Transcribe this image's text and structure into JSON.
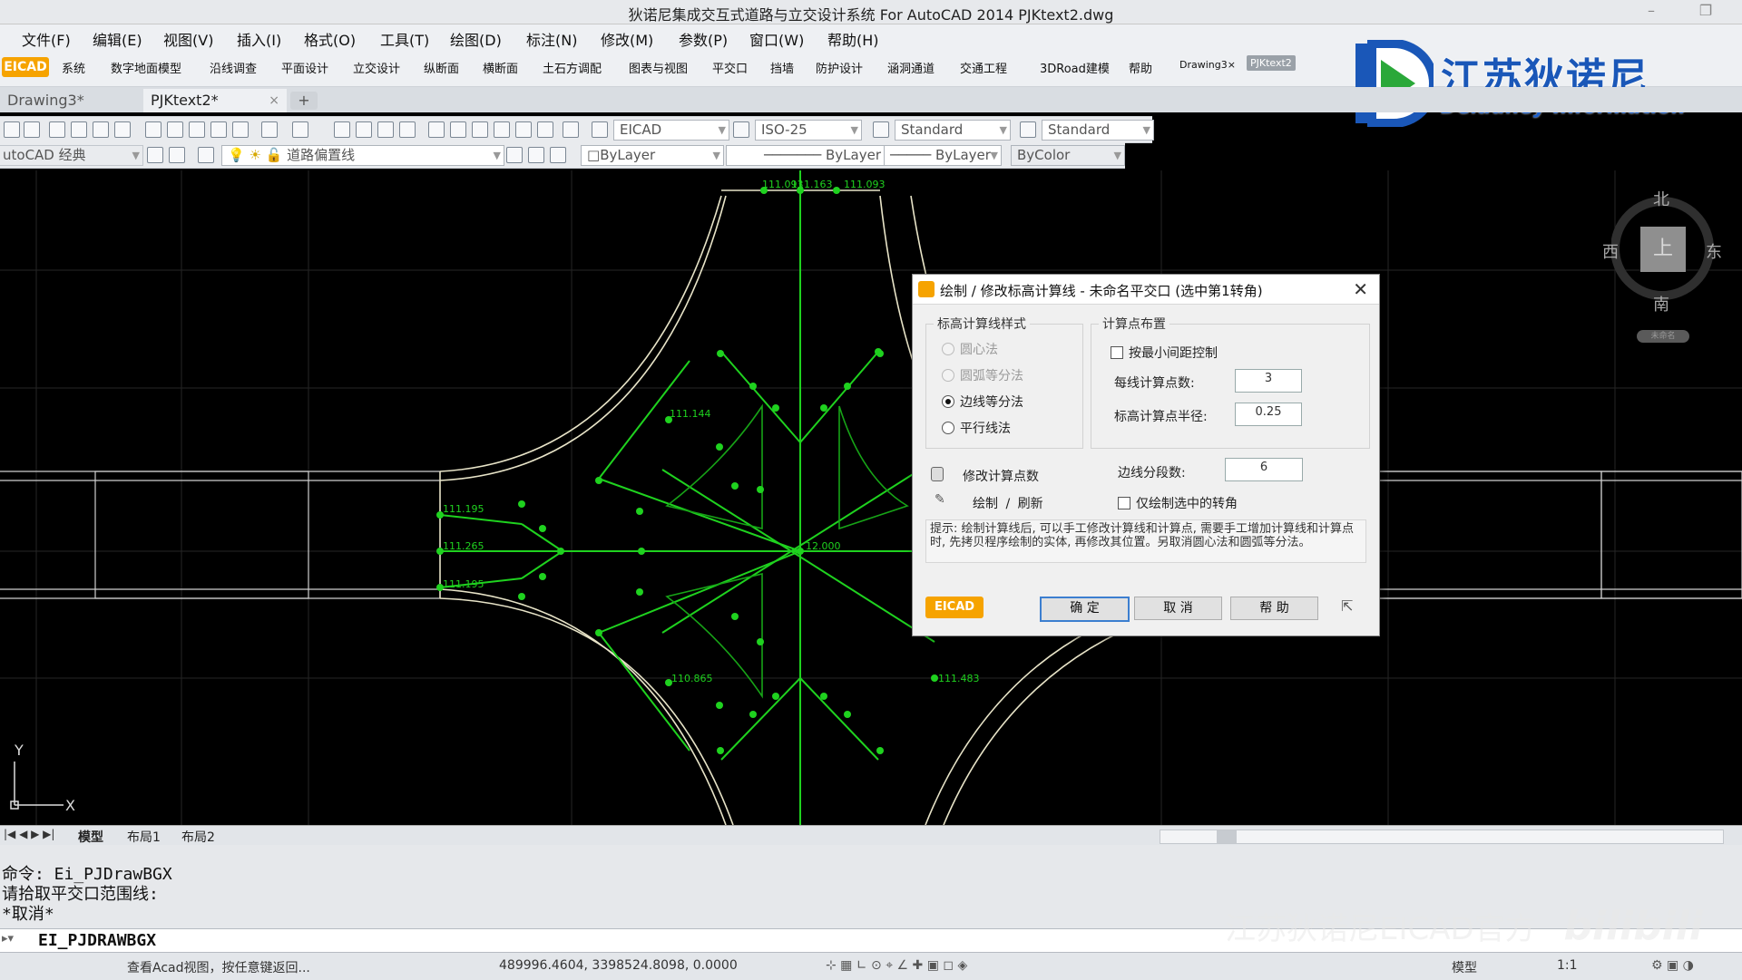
{
  "window": {
    "title": "狄诺尼集成交互式道路与立交设计系统 For AutoCAD 2014    PJKtext2.dwg"
  },
  "menu": [
    "文件(F)",
    "编辑(E)",
    "视图(V)",
    "插入(I)",
    "格式(O)",
    "工具(T)",
    "绘图(D)",
    "标注(N)",
    "修改(M)",
    "参数(P)",
    "窗口(W)",
    "帮助(H)"
  ],
  "ribbon": {
    "logo": "EICAD",
    "items": [
      "系统",
      "数字地面模型",
      "沿线调查",
      "平面设计",
      "立交设计",
      "纵断面",
      "横断面",
      "土石方调配",
      "图表与视图",
      "平交口",
      "挡墙",
      "防护设计",
      "涵洞通道",
      "交通工程",
      "3DRoad建模",
      "帮助",
      "Drawing3×",
      "PJKtext2"
    ]
  },
  "brand": {
    "name_cn": "江苏狄诺尼",
    "name_en": "Delauney Information"
  },
  "tabs": [
    {
      "label": "Drawing3*",
      "close": ""
    },
    {
      "label": "PJKtext2*",
      "close": "×"
    }
  ],
  "toolbar1": {
    "text_style": "EICAD",
    "dim_style": "ISO-25",
    "table_style": "Standard",
    "ml_style": "Standard"
  },
  "toolbar2": {
    "workspace": "utoCAD 经典",
    "layer": "道路偏置线",
    "color": "ByLayer",
    "linetype": "ByLayer",
    "lineweight": "ByLayer",
    "plotstyle": "ByColor"
  },
  "drawing": {
    "labels": [
      "111.093",
      "111.163",
      "111.093",
      "111.144",
      "111.195",
      "111.265",
      "111.195",
      "12.000",
      "110.865",
      "111.483"
    ],
    "ucs": {
      "x": "X",
      "y": "Y"
    }
  },
  "compass": {
    "north": "北",
    "south": "南",
    "east": "东",
    "west": "西",
    "top": "上",
    "wcs": "未命名"
  },
  "dialog": {
    "title": "绘制 / 修改标高计算线 - 未命名平交口 (选中第1转角)",
    "group1_label": "标高计算线样式",
    "radios": [
      {
        "label": "圆心法",
        "state": "disabled"
      },
      {
        "label": "圆弧等分法",
        "state": "disabled"
      },
      {
        "label": "边线等分法",
        "state": "selected"
      },
      {
        "label": "平行线法",
        "state": "normal"
      }
    ],
    "group2_label": "计算点布置",
    "min_spacing_label": "按最小间距控制",
    "points_per_line_label": "每线计算点数:",
    "points_per_line_value": "3",
    "radius_label": "标高计算点半径:",
    "radius_value": "0.25",
    "modify_points_label": "修改计算点数",
    "segments_label": "边线分段数:",
    "segments_value": "6",
    "draw_refresh_label": "绘制 / 刷新",
    "only_selected_label": "仅绘制选中的转角",
    "hint": "提示: 绘制计算线后, 可以手工修改计算线和计算点, 需要手工增加计算线和计算点时, 先拷贝程序绘制的实体, 再修改其位置。另取消圆心法和圆弧等分法。",
    "logo": "EICAD",
    "ok": "确 定",
    "cancel": "取 消",
    "help": "帮 助"
  },
  "layout_tabs": [
    "模型",
    "布局1",
    "布局2"
  ],
  "command": {
    "history": [
      "命令: Ei_PJDrawBGX",
      "请拾取平交口范围线:",
      "*取消*"
    ],
    "input": "EI_PJDRAWBGX"
  },
  "status": {
    "hint": "查看Acad视图，按任意键返回...",
    "coords": "489996.4604,  3398524.8098,  0.0000",
    "model": "模型",
    "scale": "1:1"
  },
  "watermark": "江苏狄诺尼EICAD官方",
  "colors": {
    "accent": "#1a57b8",
    "drawing_green": "#1fd21f",
    "drawing_white": "#e8e4c8",
    "dialog_default_border": "#3c7fd0"
  }
}
